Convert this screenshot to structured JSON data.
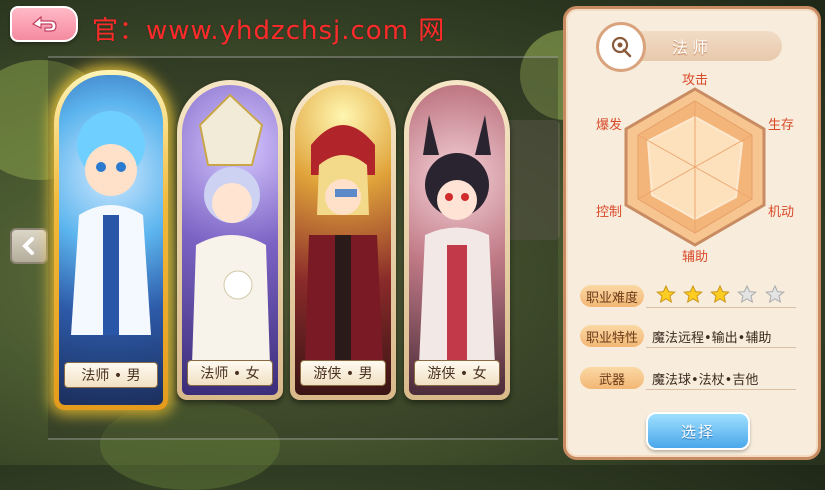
{
  "watermark": "官：www.yhdzchsj.com 网",
  "cards": [
    {
      "label": "法师 • 男",
      "selected": true
    },
    {
      "label": "法师 • 女",
      "selected": false
    },
    {
      "label": "游侠 • 男",
      "selected": false
    },
    {
      "label": "游侠 • 女",
      "selected": false
    }
  ],
  "panel": {
    "class_name": "法师",
    "stats": {
      "attack": "攻击",
      "survival": "生存",
      "mobility": "机动",
      "support": "辅助",
      "control": "控制",
      "burst": "爆发"
    },
    "difficulty": {
      "label": "职业难度",
      "stars_filled": 3,
      "stars_total": 5
    },
    "traits": {
      "label": "职业特性",
      "value": "魔法远程•输出•辅助"
    },
    "weapon": {
      "label": "武器",
      "value": "魔法球•法杖•吉他"
    },
    "select_button": "选择"
  },
  "icons": {
    "back": "back-arrow-icon",
    "prev": "chevron-left-icon",
    "emblem": "wand-icon",
    "star": "star-icon"
  },
  "colors": {
    "accent_orange": "#f2b775",
    "select_blue": "#4aa7ea",
    "stat_red": "#d84a2a"
  }
}
